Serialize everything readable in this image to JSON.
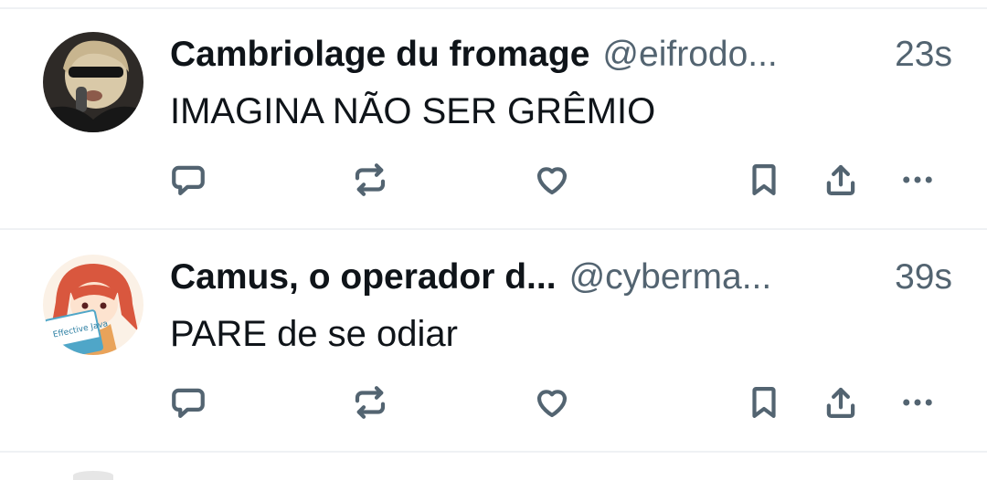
{
  "tweets": [
    {
      "name": "Cambriolage du fromage",
      "handle": "@eifrodo...",
      "time": "23s",
      "text": "IMAGINA NÃO SER GRÊMIO"
    },
    {
      "name": "Camus, o operador d...",
      "handle": "@cyberma...",
      "time": "39s",
      "text": "PARE de se odiar"
    }
  ],
  "icons": [
    "reply-icon",
    "retweet-icon",
    "like-icon",
    "bookmark-icon",
    "share-icon",
    "more-icon"
  ],
  "colors": {
    "text": "#0f1419",
    "secondary": "#536471",
    "divider": "#eff1f4"
  }
}
